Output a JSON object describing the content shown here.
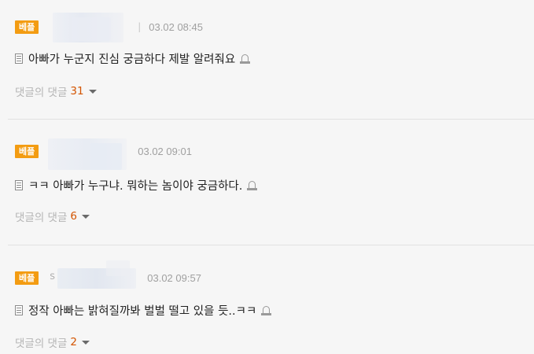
{
  "comments": [
    {
      "badge": "베플",
      "separator": "|",
      "time": "03.02 08:45",
      "text": "아빠가 누군지 진심 궁금하다 제발 알려줘요",
      "reply_label": "댓글의 댓글",
      "reply_count": "31"
    },
    {
      "badge": "베플",
      "time": "03.02 09:01",
      "text": "ㅋㅋ 아빠가 누구냐. 뭐하는 놈이야 궁금하다.",
      "reply_label": "댓글의 댓글",
      "reply_count": "6"
    },
    {
      "badge": "베플",
      "nick_initial": "s",
      "time": "03.02 09:57",
      "text": "정작 아빠는 밝혀질까봐 벌벌 떨고 있을 듯..ㅋㅋ",
      "reply_label": "댓글의 댓글",
      "reply_count": "2"
    }
  ],
  "colors": {
    "badge_bg": "#f39c12",
    "reply_count": "#d35400",
    "background": "#f6f6f6"
  },
  "icons": {
    "content": "document-icon",
    "report": "siren-icon",
    "expand": "caret-down-icon"
  }
}
